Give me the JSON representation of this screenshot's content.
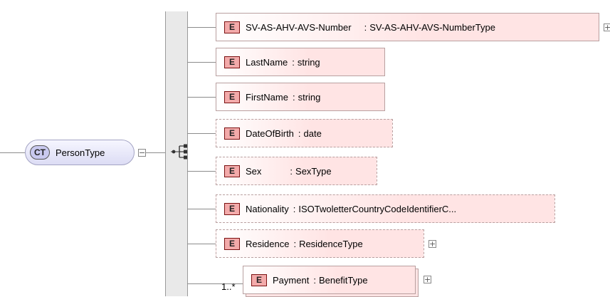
{
  "complex_type": {
    "badge": "CT",
    "name": "PersonType"
  },
  "elements": [
    {
      "badge": "E",
      "name": "SV-AS-AHV-AVS-Number",
      "separator": ":",
      "type": "SV-AS-AHV-AVS-NumberType",
      "optional": false,
      "expand": "+"
    },
    {
      "badge": "E",
      "name": "LastName",
      "separator": ":",
      "type": "string",
      "optional": false
    },
    {
      "badge": "E",
      "name": "FirstName",
      "separator": ":",
      "type": "string",
      "optional": false
    },
    {
      "badge": "E",
      "name": "DateOfBirth",
      "separator": ":",
      "type": "date",
      "optional": true
    },
    {
      "badge": "E",
      "name": "Sex",
      "separator": ":",
      "type": "SexType",
      "optional": true
    },
    {
      "badge": "E",
      "name": "Nationality",
      "separator": ":",
      "type": "ISOTwoletterCountryCodeIdentifierC...",
      "optional": true
    },
    {
      "badge": "E",
      "name": "Residence",
      "separator": ":",
      "type": "ResidenceType",
      "optional": true,
      "expand": "+"
    },
    {
      "badge": "E",
      "name": "Payment",
      "separator": ":",
      "type": "BenefitType",
      "optional": false,
      "expand": "+",
      "multiplicity": "1..*"
    }
  ],
  "controls": {
    "ct_collapse": "−",
    "sequence_icon": "sequence-compositor"
  },
  "colors": {
    "element_fill": "#ffe4e4",
    "element_badge": "#f3aaaa",
    "ct_fill": "#dcdcf4",
    "ct_badge": "#c9c9ef",
    "sequence_bar": "#e9e9e9"
  }
}
